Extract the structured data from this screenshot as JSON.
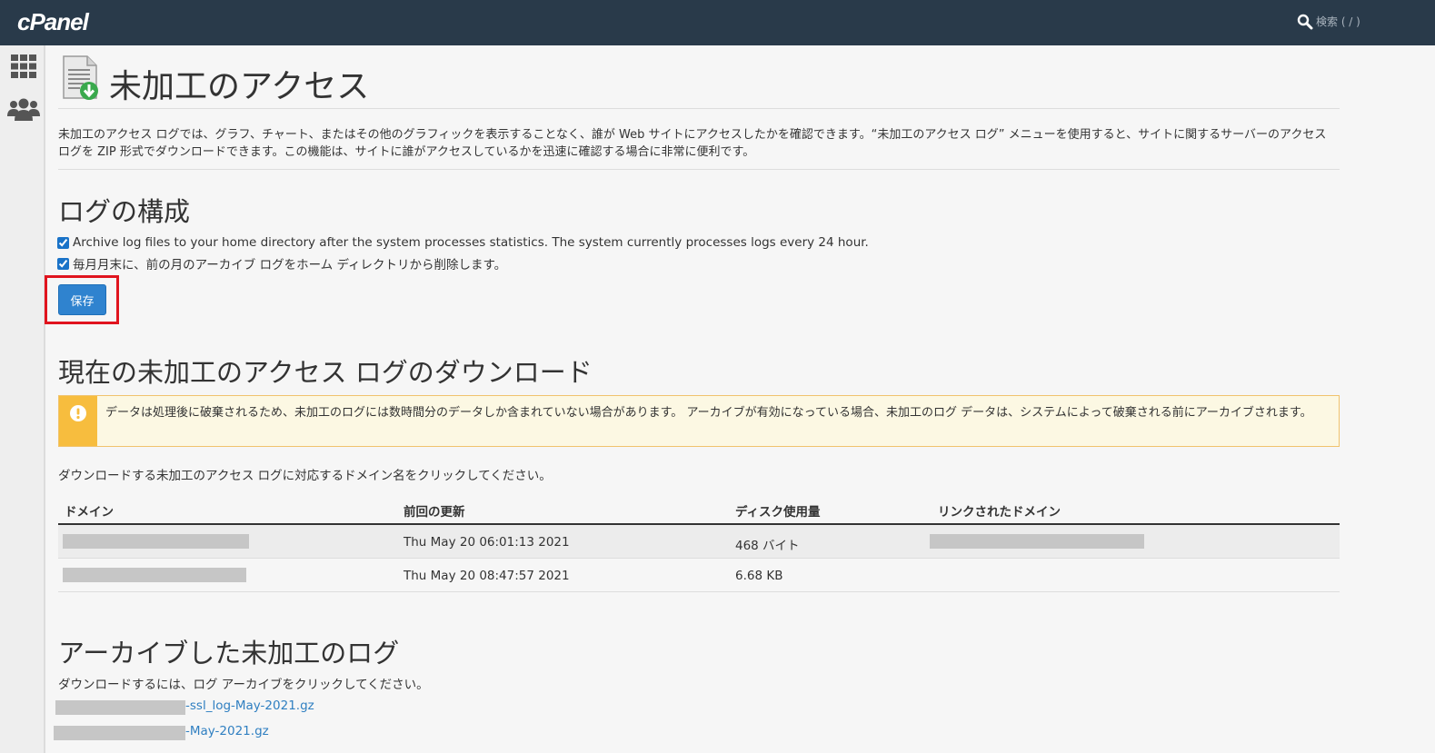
{
  "app": {
    "logo": "cPanel"
  },
  "search": {
    "placeholder": "検索 ( / )"
  },
  "page": {
    "title": "未加工のアクセス",
    "description": "未加工のアクセス ログでは、グラフ、チャート、またはその他のグラフィックを表示することなく、誰が Web サイトにアクセスしたかを確認できます。“未加工のアクセス ログ” メニューを使用すると、サイトに関するサーバーのアクセス ログを ZIP 形式でダウンロードできます。この機能は、サイトに誰がアクセスしているかを迅速に確認する場合に非常に便利です。"
  },
  "log_config": {
    "heading": "ログの構成",
    "options": [
      {
        "label": "Archive log files to your home directory after the system processes statistics. The system currently processes logs every 24 hour.",
        "checked": true
      },
      {
        "label": "毎月月末に、前の月のアーカイブ ログをホーム ディレクトリから削除します。",
        "checked": true
      }
    ],
    "save_label": "保存"
  },
  "download": {
    "heading": "現在の未加工のアクセス ログのダウンロード",
    "alert": "データは処理後に破棄されるため、未加工のログには数時間分のデータしか含まれていない場合があります。 アーカイブが有効になっている場合、未加工のログ データは、システムによって破棄される前にアーカイブされます。",
    "instruction": "ダウンロードする未加工のアクセス ログに対応するドメイン名をクリックしてください。",
    "columns": [
      "ドメイン",
      "前回の更新",
      "ディスク使用量",
      "リンクされたドメイン"
    ],
    "rows": [
      {
        "updated": "Thu May 20 06:01:13 2021",
        "disk": "468 バイト"
      },
      {
        "updated": "Thu May 20 08:47:57 2021",
        "disk": "6.68 KB"
      }
    ]
  },
  "archive": {
    "heading": "アーカイブした未加工のログ",
    "instruction": "ダウンロードするには、ログ アーカイブをクリックしてください。",
    "files": [
      {
        "suffix": "-ssl_log-May-2021.gz"
      },
      {
        "suffix": "-May-2021.gz"
      }
    ]
  },
  "colors": {
    "topbar": "#293a4a",
    "primary_button": "#2f83cf",
    "highlight": "#e0141e",
    "alert_strip": "#f7bd3e",
    "link": "#2f7fc1"
  }
}
